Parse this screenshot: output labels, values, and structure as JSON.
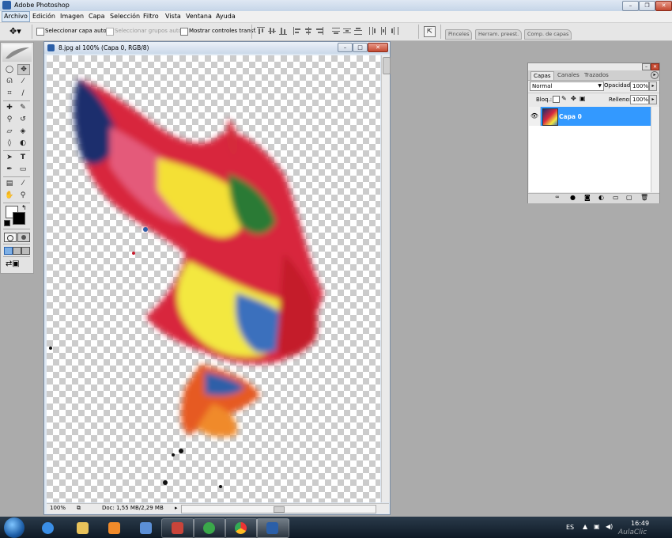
{
  "window": {
    "title": "Adobe Photoshop"
  },
  "menu": [
    "Archivo",
    "Edición",
    "Imagen",
    "Capa",
    "Selección",
    "Filtro",
    "Vista",
    "Ventana",
    "Ayuda"
  ],
  "options": {
    "auto_select_layer": "Seleccionar capa autom.",
    "auto_select_groups": "Seleccionar grupos autom.",
    "show_transform": "Mostrar controles transf.",
    "wells": [
      "Pinceles",
      "Herram. preest.",
      "Comp. de capas"
    ]
  },
  "document": {
    "title": "8.jpg al 100% (Capa 0, RGB/8)",
    "zoom": "100%",
    "doc_info": "Doc: 1,55 MB/2,29 MB"
  },
  "layers_panel": {
    "tabs": [
      "Capas",
      "Canales",
      "Trazados"
    ],
    "blend_mode": "Normal",
    "opacity_label": "Opacidad:",
    "opacity_value": "100%",
    "lock_label": "Bloq.:",
    "fill_label": "Relleno:",
    "fill_value": "100%",
    "layer_name": "Capa 0"
  },
  "taskbar": {
    "lang": "ES",
    "time": "16:49",
    "watermark": "AulaClic"
  },
  "colors": {
    "selection": "#3399ff",
    "taskbar": "#1b2836",
    "canvas_check": "#cccccc"
  }
}
